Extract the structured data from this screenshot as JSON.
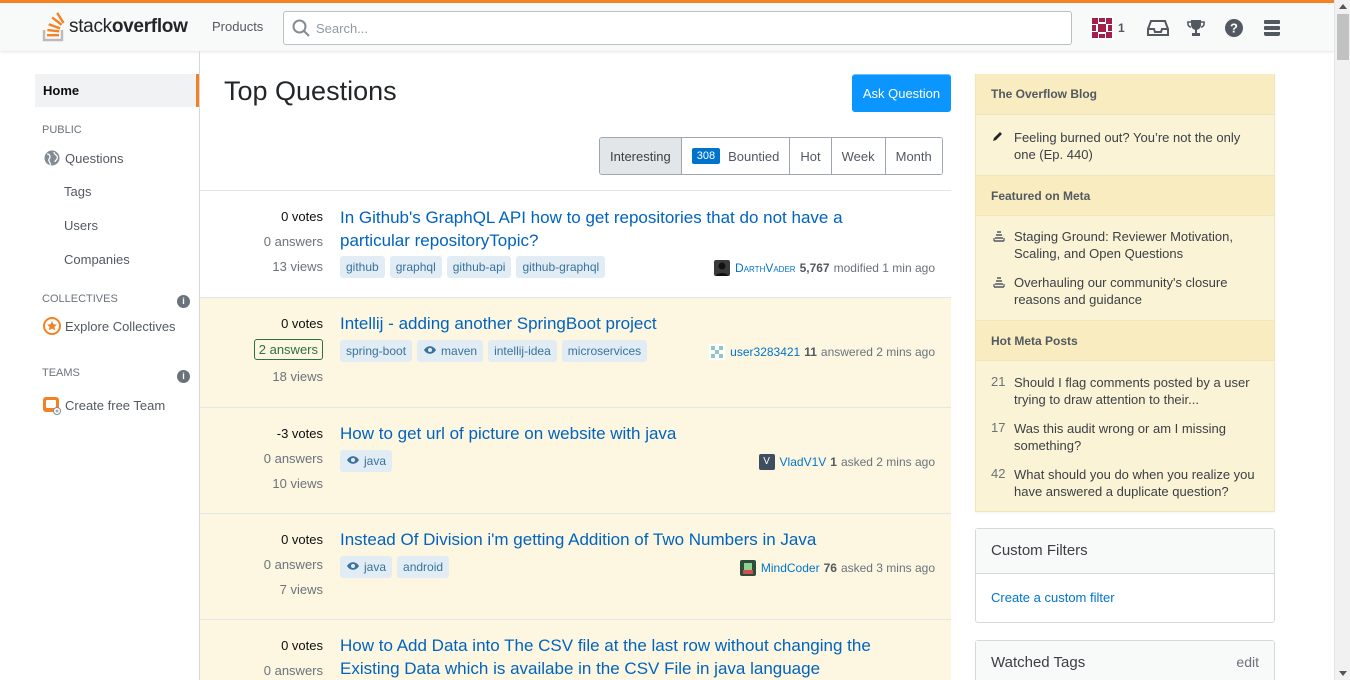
{
  "header": {
    "logo_text_light": "stack",
    "logo_text_bold": "overflow",
    "products_label": "Products",
    "search_placeholder": "Search...",
    "reputation": "1"
  },
  "sidebar": {
    "home": "Home",
    "public_label": "PUBLIC",
    "questions": "Questions",
    "tags": "Tags",
    "users": "Users",
    "companies": "Companies",
    "collectives_label": "COLLECTIVES",
    "explore_collectives": "Explore Collectives",
    "teams_label": "TEAMS",
    "create_team": "Create free Team"
  },
  "main": {
    "title": "Top Questions",
    "ask_button": "Ask Question",
    "filters": {
      "interesting": "Interesting",
      "bounty_count": "308",
      "bountied": "Bountied",
      "hot": "Hot",
      "week": "Week",
      "month": "Month"
    },
    "questions": [
      {
        "votes": "0 votes",
        "answers": "0 answers",
        "views": "13 views",
        "title": "In Github's GraphQL API how to get repositories that do not have a particular repositoryTopic?",
        "tags": [
          "github",
          "graphql",
          "github-api",
          "github-graphql"
        ],
        "user": "DarthVader",
        "rep": "5,767",
        "action": "modified 1 min ago"
      },
      {
        "votes": "0 votes",
        "answers": "2 answers",
        "views": "18 views",
        "title": "Intellij - adding another SpringBoot project",
        "tags": [
          "spring-boot",
          "maven",
          "intellij-idea",
          "microservices"
        ],
        "user": "user3283421",
        "rep": "11",
        "action": "answered 2 mins ago"
      },
      {
        "votes": "-3 votes",
        "answers": "0 answers",
        "views": "10 views",
        "title": "How to get url of picture on website with java",
        "tags": [
          "java"
        ],
        "user": "VladV1V",
        "rep": "1",
        "action": "asked 2 mins ago",
        "avatar_letter": "V"
      },
      {
        "votes": "0 votes",
        "answers": "0 answers",
        "views": "7 views",
        "title": "Instead Of Division i'm getting Addition of Two Numbers in Java",
        "tags": [
          "java",
          "android"
        ],
        "user": "MindCoder",
        "rep": "76",
        "action": "asked 3 mins ago"
      },
      {
        "votes": "0 votes",
        "answers": "0 answers",
        "title": "How to Add Data into The CSV file at the last row without changing the Existing Data which is availabe in the CSV File in java language"
      }
    ]
  },
  "right": {
    "blog_title": "The Overflow Blog",
    "blog_items": [
      "Feeling burned out? You’re not the only one (Ep. 440)"
    ],
    "meta_title": "Featured on Meta",
    "meta_items": [
      "Staging Ground: Reviewer Motivation, Scaling, and Open Questions",
      "Overhauling our community's closure reasons and guidance"
    ],
    "hot_title": "Hot Meta Posts",
    "hot_items": [
      {
        "count": "21",
        "text": "Should I flag comments posted by a user trying to draw attention to their..."
      },
      {
        "count": "17",
        "text": "Was this audit wrong or am I missing something?"
      },
      {
        "count": "42",
        "text": "What should you do when you realize you have answered a duplicate question?"
      }
    ],
    "custom_filters_title": "Custom Filters",
    "create_filter": "Create a custom filter",
    "watched_tags_title": "Watched Tags",
    "watched_tags_edit": "edit"
  },
  "colors": {
    "accent": "#f48225",
    "link": "#0063bf",
    "button": "#0a95ff",
    "watched_bg": "#fdf7e2",
    "answered": "#2f6f44"
  }
}
